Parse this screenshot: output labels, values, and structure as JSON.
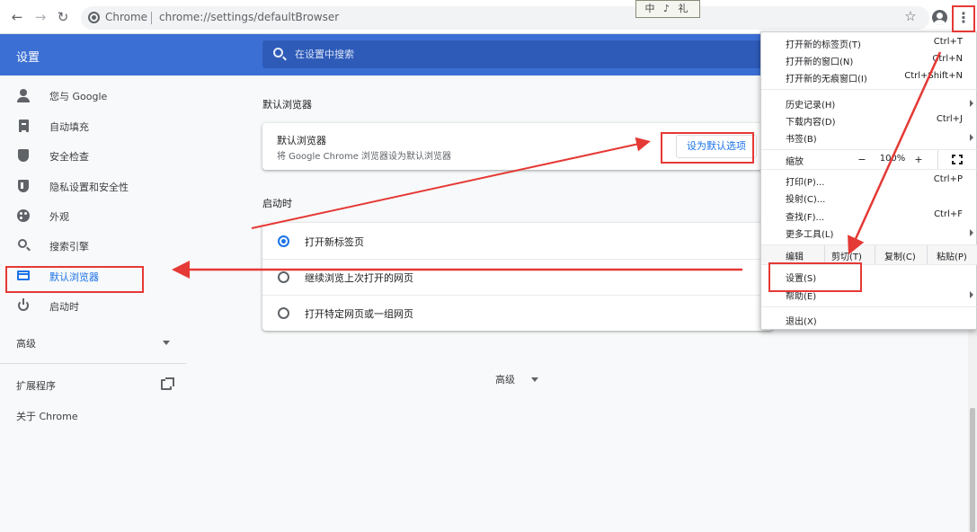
{
  "toolbar": {
    "back_icon": "back-arrow-icon",
    "forward_icon": "forward-arrow-icon",
    "reload_icon": "reload-icon",
    "site_label": "Chrome",
    "url": "chrome://settings/defaultBrowser",
    "ime_indicator": "中 ♪ 礼"
  },
  "header": {
    "title": "设置",
    "search_placeholder": "在设置中搜索",
    "accent_color": "#3b6fd4"
  },
  "sidebar": {
    "items": [
      {
        "label": "您与 Google",
        "icon": "person-icon"
      },
      {
        "label": "自动填充",
        "icon": "clipboard-icon"
      },
      {
        "label": "安全检查",
        "icon": "shield-check-icon"
      },
      {
        "label": "隐私设置和安全性",
        "icon": "shield-icon"
      },
      {
        "label": "外观",
        "icon": "palette-icon"
      },
      {
        "label": "搜索引擎",
        "icon": "search-icon"
      },
      {
        "label": "默认浏览器",
        "icon": "browser-icon",
        "active": true
      },
      {
        "label": "启动时",
        "icon": "power-icon"
      }
    ],
    "advanced_label": "高级",
    "extensions_label": "扩展程序",
    "about_label": "关于 Chrome"
  },
  "main": {
    "default_browser": {
      "section_title": "默认浏览器",
      "card_title": "默认浏览器",
      "card_subtitle": "将 Google Chrome 浏览器设为默认浏览器",
      "button_label": "设为默认选项"
    },
    "startup": {
      "section_title": "启动时",
      "options": [
        {
          "label": "打开新标签页",
          "checked": true
        },
        {
          "label": "继续浏览上次打开的网页",
          "checked": false
        },
        {
          "label": "打开特定网页或一组网页",
          "checked": false
        }
      ]
    },
    "advanced_label": "高级"
  },
  "menu": {
    "group1": [
      {
        "label": "打开新的标签页(T)",
        "shortcut": "Ctrl+T"
      },
      {
        "label": "打开新的窗口(N)",
        "shortcut": "Ctrl+N"
      },
      {
        "label": "打开新的无痕窗口(I)",
        "shortcut": "Ctrl+Shift+N"
      }
    ],
    "group2": [
      {
        "label": "历史记录(H)",
        "shortcut": ""
      },
      {
        "label": "下载内容(D)",
        "shortcut": "Ctrl+J"
      },
      {
        "label": "书签(B)",
        "shortcut": ""
      }
    ],
    "zoom": {
      "label": "缩放",
      "minus": "−",
      "value": "100%",
      "plus": "+"
    },
    "group3": [
      {
        "label": "打印(P)...",
        "shortcut": "Ctrl+P"
      },
      {
        "label": "投射(C)...",
        "shortcut": ""
      },
      {
        "label": "查找(F)...",
        "shortcut": "Ctrl+F"
      },
      {
        "label": "更多工具(L)",
        "shortcut": ""
      }
    ],
    "edit": {
      "label": "编辑",
      "cut": "剪切(T)",
      "copy": "复制(C)",
      "paste": "粘贴(P)"
    },
    "group4": [
      {
        "label": "设置(S)"
      },
      {
        "label": "帮助(E)"
      }
    ],
    "exit_label": "退出(X)"
  },
  "annotation_color": "#e53935"
}
